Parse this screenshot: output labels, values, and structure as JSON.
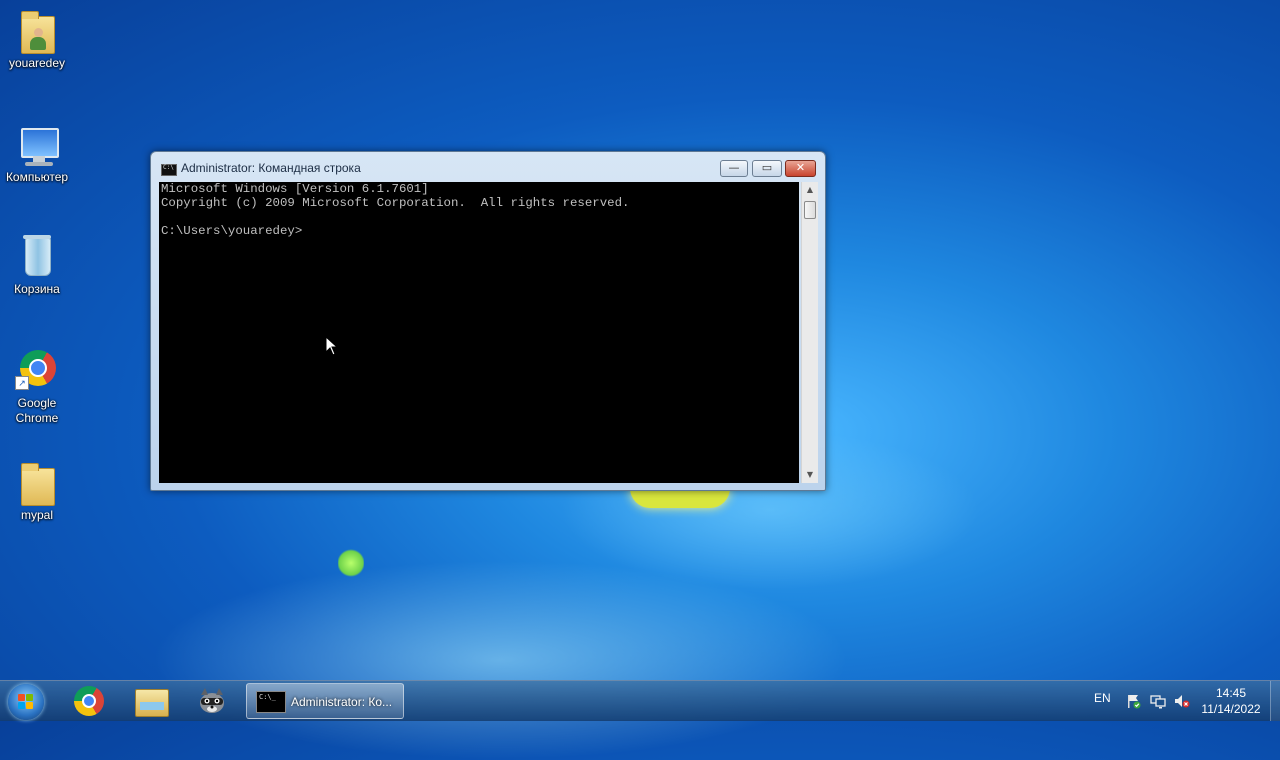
{
  "desktop": {
    "icons": [
      {
        "label": "youaredey",
        "icon": "user-folder-icon"
      },
      {
        "label": "Компьютер",
        "icon": "computer-icon"
      },
      {
        "label": "Корзина",
        "icon": "recycle-bin-icon"
      },
      {
        "label": "Google Chrome",
        "icon": "chrome-icon"
      },
      {
        "label": "mypal",
        "icon": "folder-icon"
      }
    ]
  },
  "cmd_window": {
    "title": "Administrator: Командная строка",
    "minimize_label": "—",
    "maximize_label": "▭",
    "close_label": "✕",
    "console_lines": [
      "Microsoft Windows [Version 6.1.7601]",
      "Copyright (c) 2009 Microsoft Corporation.  All rights reserved.",
      "",
      "C:\\Users\\youaredey>"
    ]
  },
  "taskbar": {
    "pinned": [
      {
        "name": "Google Chrome",
        "icon": "chrome-icon"
      },
      {
        "name": "Windows Explorer",
        "icon": "explorer-icon"
      },
      {
        "name": "Raccoon app",
        "icon": "raccoon-icon"
      }
    ],
    "active_window_label": "Administrator: Ко...",
    "tray": {
      "language": "EN",
      "clock_time": "14:45",
      "clock_date": "11/14/2022"
    }
  },
  "colors": {
    "console_bg": "#000000",
    "console_text": "#c0c0c0",
    "close_button": "#c8432d"
  }
}
